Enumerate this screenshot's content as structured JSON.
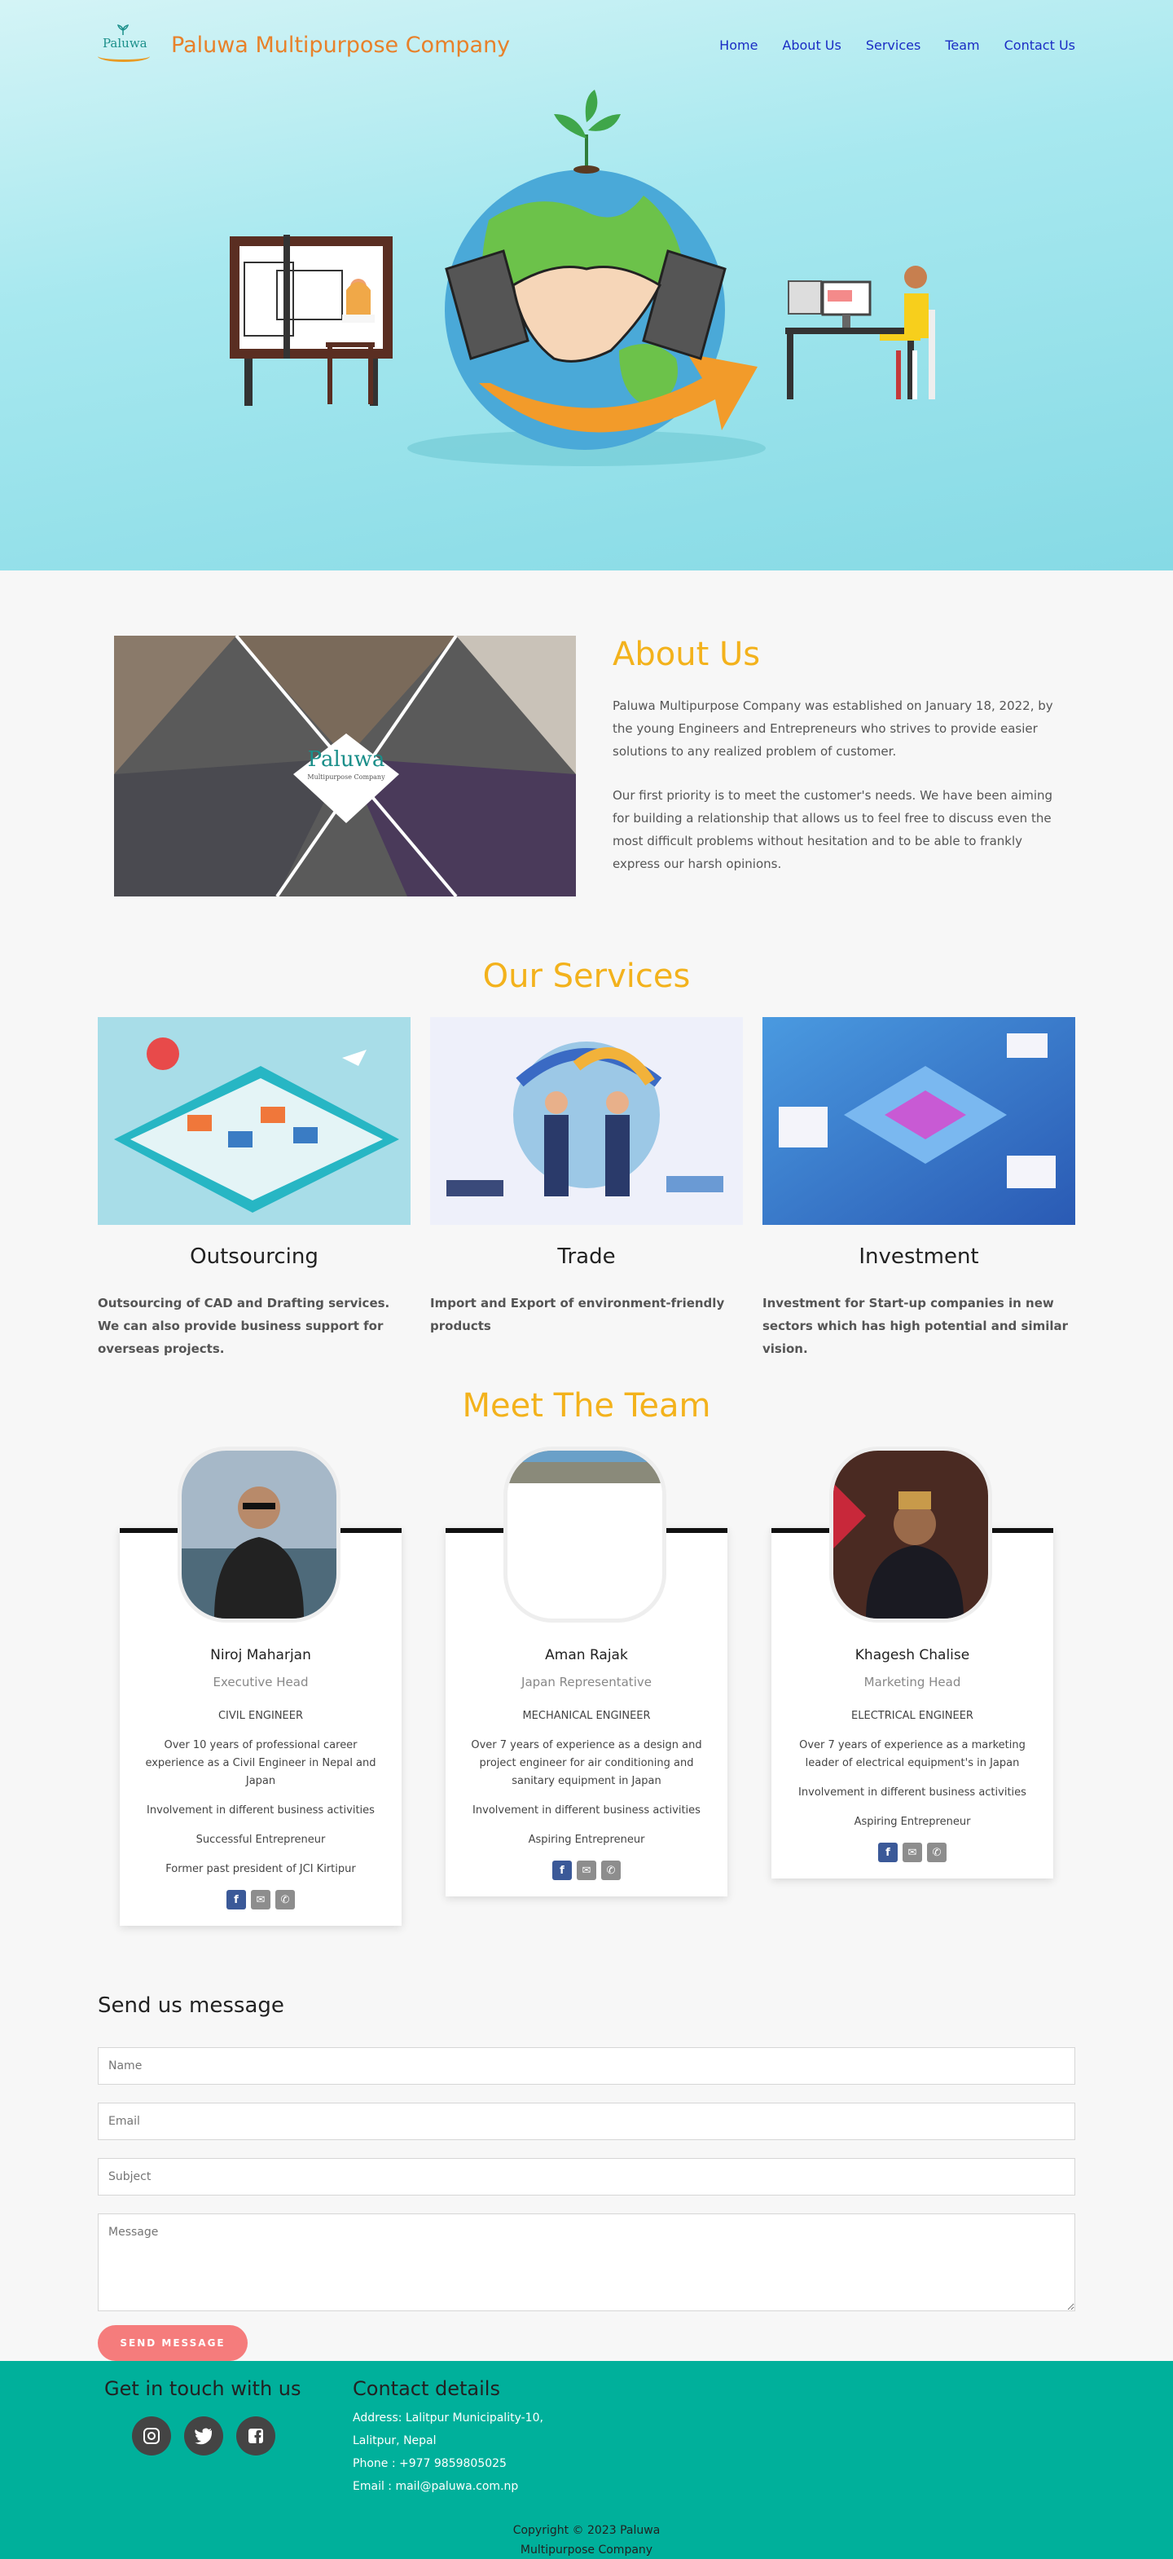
{
  "nav": {
    "brand": "Paluwa Multipurpose Company",
    "logo_text": "Paluwa",
    "links": [
      "Home",
      "About Us",
      "Services",
      "Team",
      "Contact Us"
    ]
  },
  "about": {
    "title": "About Us",
    "image_logo_text": "Paluwa",
    "image_logo_sub": "Multipurpose Company",
    "para1": "Paluwa Multipurpose Company was established on January 18, 2022, by the young Engineers and Entrepreneurs who strives to provide easier solutions to any realized problem of customer.",
    "para2": "Our first priority is to meet the customer's needs. We have been aiming for building a relationship that allows us to feel free to discuss even the most difficult problems without hesitation and to be able to frankly express our harsh opinions."
  },
  "services": {
    "title": "Our Services",
    "items": [
      {
        "name": "Outsourcing",
        "desc": "Outsourcing of CAD and Drafting services. We can also provide business support for overseas projects."
      },
      {
        "name": "Trade",
        "desc": "Import and Export of environment-friendly products"
      },
      {
        "name": "Investment",
        "desc": "Investment for Start-up companies in new sectors which has high potential and similar vision."
      }
    ]
  },
  "team": {
    "title": "Meet The Team",
    "members": [
      {
        "name": "Niroj Maharjan",
        "role": "Executive Head",
        "lines": [
          "CIVIL ENGINEER",
          "Over 10 years of professional career experience as a Civil Engineer in Nepal and Japan",
          "Involvement in different business activities",
          "Successful Entrepreneur",
          "Former past president of JCI Kirtipur"
        ]
      },
      {
        "name": "Aman Rajak",
        "role": "Japan Representative",
        "lines": [
          "MECHANICAL ENGINEER",
          "Over 7 years of experience as a design and project engineer for air conditioning and sanitary equipment in Japan",
          "Involvement in different business activities",
          "Aspiring Entrepreneur"
        ]
      },
      {
        "name": "Khagesh Chalise",
        "role": "Marketing Head",
        "lines": [
          "ELECTRICAL  ENGINEER",
          "Over 7 years of experience as a marketing leader of  electrical equipment's in Japan",
          "Involvement in different business activities",
          "Aspiring Entrepreneur"
        ]
      }
    ]
  },
  "contact": {
    "title": "Send us message",
    "name_placeholder": "Name",
    "email_placeholder": "Email",
    "subject_placeholder": "Subject",
    "message_placeholder": "Message",
    "send_label": "SEND MESSAGE"
  },
  "footer": {
    "touch_title": "Get in touch with us",
    "details_title": "Contact details",
    "address_line1": "Address: Lalitpur Municipality-10,",
    "address_line2": "Lalitpur, Nepal",
    "phone": "Phone : +977 9859805025",
    "email": "Email : mail@paluwa.com.np",
    "copyright_line1": "Copyright © 2023 Paluwa",
    "copyright_line2": "Multipurpose Company",
    "social_icons": [
      "instagram-icon",
      "twitter-icon",
      "facebook-icon"
    ]
  },
  "colors": {
    "accent": "#f3b21c",
    "brand": "#e8812a",
    "nav_link": "#1a2cc4",
    "footer_bg": "#00b09b",
    "button": "#f57c7c"
  }
}
